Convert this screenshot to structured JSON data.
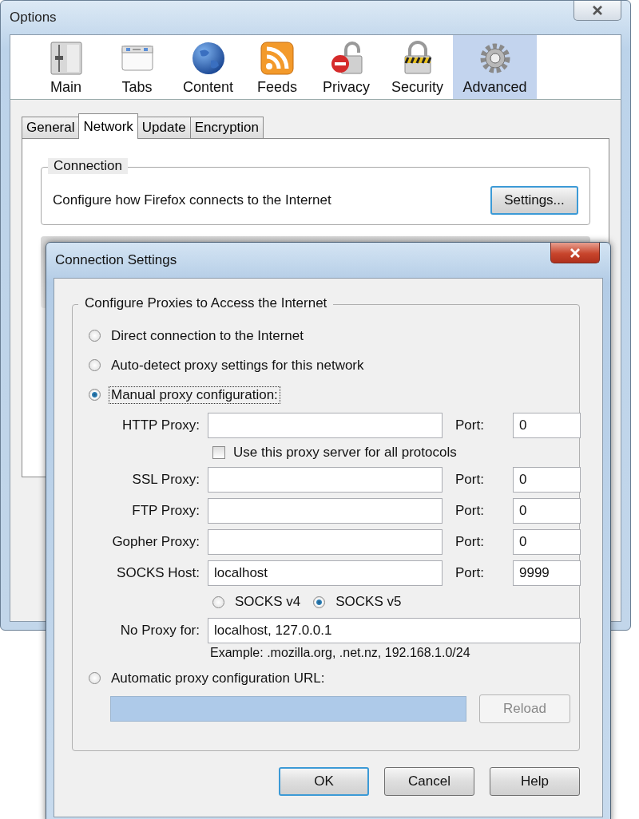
{
  "window": {
    "title": "Options"
  },
  "categories": [
    {
      "label": "Main",
      "kind": "sliders",
      "selected": false
    },
    {
      "label": "Tabs",
      "kind": "tabs",
      "selected": false
    },
    {
      "label": "Content",
      "kind": "globe",
      "selected": false
    },
    {
      "label": "Feeds",
      "kind": "feed",
      "selected": false
    },
    {
      "label": "Privacy",
      "kind": "blocked",
      "selected": false
    },
    {
      "label": "Security",
      "kind": "striped",
      "selected": false
    },
    {
      "label": "Advanced",
      "kind": "gear",
      "selected": true
    }
  ],
  "tabs": [
    {
      "label": "General",
      "selected": false
    },
    {
      "label": "Network",
      "selected": true
    },
    {
      "label": "Update",
      "selected": false
    },
    {
      "label": "Encryption",
      "selected": false
    }
  ],
  "connection": {
    "title": "Connection",
    "description": "Configure how Firefox connects to the Internet",
    "button": "Settings..."
  },
  "dialog": {
    "title": "Connection Settings",
    "group_title": "Configure Proxies to Access the Internet",
    "modes": [
      {
        "label": "Direct connection to the Internet",
        "selected": false,
        "focused": false
      },
      {
        "label": "Auto-detect proxy settings for this network",
        "selected": false,
        "focused": false
      },
      {
        "label": "Manual proxy configuration:",
        "selected": true,
        "focused": true
      },
      {
        "label": "Automatic proxy configuration URL:",
        "selected": false,
        "focused": false
      }
    ],
    "proxies": [
      {
        "label": "HTTP Proxy:",
        "port_label": "Port:",
        "port": "0"
      },
      {
        "label": "SSL Proxy:",
        "port_label": "Port:",
        "port": "0"
      },
      {
        "label": "FTP Proxy:",
        "port_label": "Port:",
        "port": "0"
      },
      {
        "label": "Gopher Proxy:",
        "port_label": "Port:",
        "port": "0"
      },
      {
        "label": "SOCKS Host:",
        "value": "localhost",
        "port_label": "Port:",
        "port": "9999"
      }
    ],
    "share_all": {
      "label": "Use this proxy server for all protocols",
      "checked": false
    },
    "socks_versions": [
      {
        "label": "SOCKS v4",
        "selected": false
      },
      {
        "label": "SOCKS v5",
        "selected": true
      }
    ],
    "no_proxy": {
      "label": "No Proxy for:",
      "value": "localhost, 127.0.0.1"
    },
    "example": "Example: .mozilla.org, .net.nz, 192.168.1.0/24",
    "auto_url": {
      "disabled": true
    },
    "reload": {
      "label": "Reload",
      "disabled": true
    },
    "buttons": [
      {
        "label": "OK",
        "default": true
      },
      {
        "label": "Cancel",
        "default": false
      },
      {
        "label": "Help",
        "default": false
      }
    ]
  }
}
